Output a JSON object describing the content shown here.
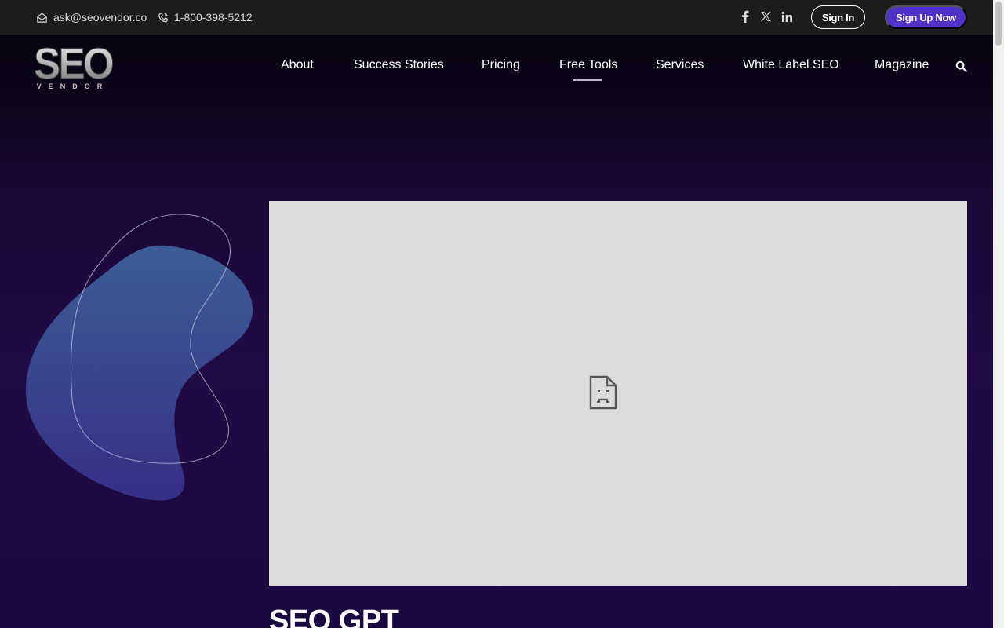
{
  "topbar": {
    "email": "ask@seovendor.co",
    "phone": "1-800-398-5212",
    "social_icons": [
      "facebook-icon",
      "x-icon",
      "linkedin-icon"
    ],
    "signin_label": "Sign In",
    "signup_label": "Sign Up Now"
  },
  "logo": {
    "main_text": "SEO",
    "sub_text": "VENDOR"
  },
  "nav": {
    "items": [
      {
        "label": "About"
      },
      {
        "label": "Success Stories"
      },
      {
        "label": "Pricing"
      },
      {
        "label": "Free Tools",
        "active": true
      },
      {
        "label": "Services"
      },
      {
        "label": "White Label SEO"
      },
      {
        "label": "Magazine"
      }
    ],
    "search_icon": "search-icon"
  },
  "hero": {
    "video_placeholder_icon": "sad-file-icon",
    "title": "SEO GPT"
  },
  "colors": {
    "topbar_bg": "#1c1c1c",
    "hero_bg": "#1a0838",
    "signup_button": "#5032c8",
    "frame_bg": "#dcdcdc",
    "blob": "#3d5b96"
  }
}
